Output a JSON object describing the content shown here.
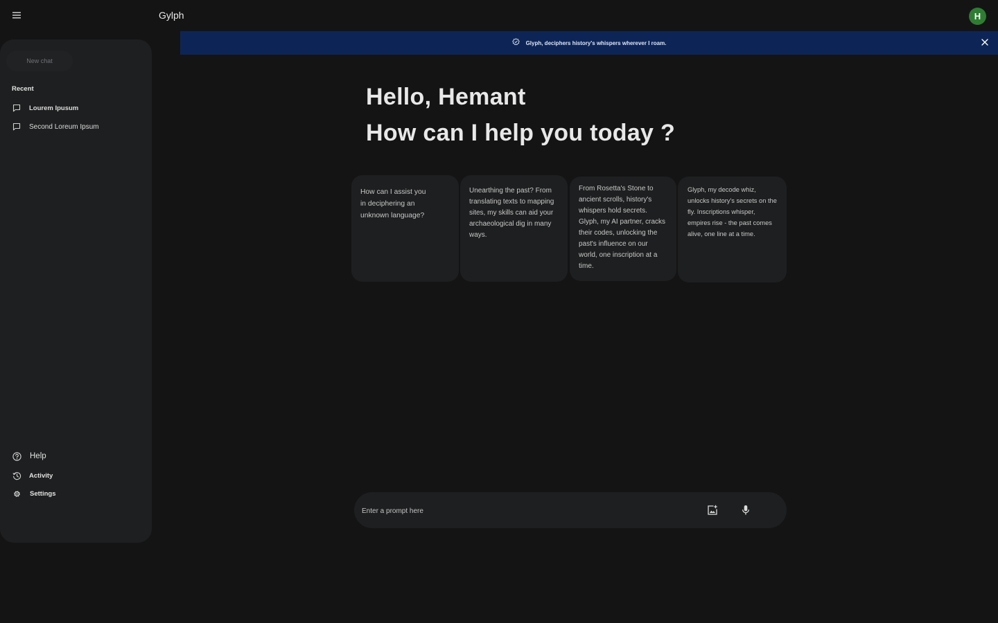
{
  "header": {
    "app_title": "Gylph",
    "menu_icon": "hamburger-menu-icon",
    "avatar_letter": "H",
    "avatar_color": "#2f7d32"
  },
  "sidebar": {
    "new_chat_label": "New chat",
    "recent_title": "Recent",
    "recent_items": [
      {
        "label": "Lourem Ipusum",
        "icon": "chat-bubble-icon"
      },
      {
        "label": "Second Loreum Ipsum",
        "icon": "chat-bubble-icon"
      }
    ],
    "bottom_items": [
      {
        "label": "Help",
        "icon": "help-circle-icon"
      },
      {
        "label": "Activity",
        "icon": "history-icon"
      },
      {
        "label": "Settings",
        "icon": "gear-icon"
      }
    ]
  },
  "banner": {
    "text": "Glyph, deciphers history's whispers wherever I roam.",
    "background": "#0d2556"
  },
  "main": {
    "greeting": "Hello, Hemant",
    "subtitle": "How can I help you today ?",
    "cards": [
      {
        "text": "How can I assist you in deciphering an unknown language?"
      },
      {
        "text": "Unearthing the past? From translating texts to mapping sites, my skills can aid your archaeological dig in many ways."
      },
      {
        "text": "From Rosetta's Stone to ancient scrolls, history's whispers hold secrets. Glyph, my AI partner, cracks their codes, unlocking the past's influence on our world, one inscription at a time."
      },
      {
        "text": "Glyph, my decode whiz, unlocks history's secrets on the fly. Inscriptions whisper, empires rise - the past comes alive, one line at a time."
      }
    ]
  },
  "prompt": {
    "placeholder": "Enter a prompt here",
    "image_button_icon": "add-image-icon",
    "mic_button_icon": "microphone-icon"
  },
  "colors": {
    "background": "#141415",
    "surface": "#1e1f20",
    "text": "#e3e3e3"
  }
}
